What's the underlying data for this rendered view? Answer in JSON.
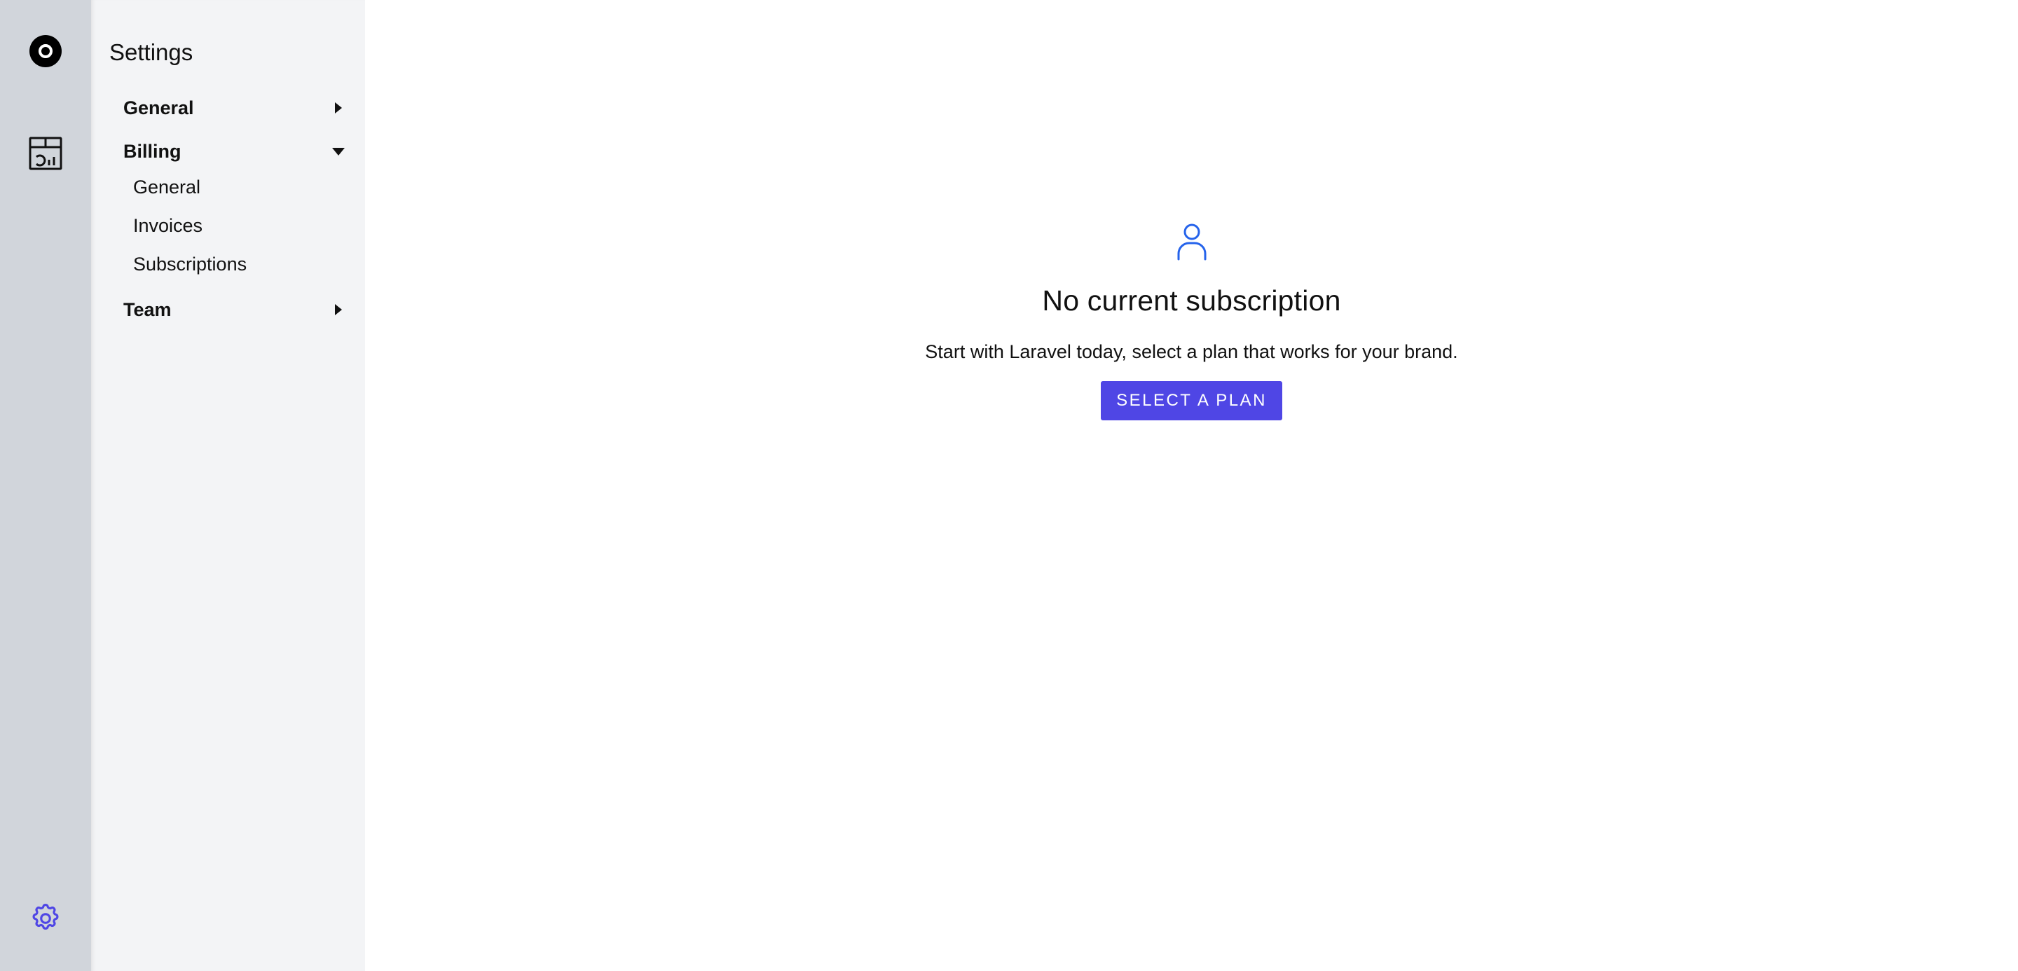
{
  "rail": {
    "icons": [
      "logo-icon",
      "dashboard-icon",
      "gear-icon"
    ],
    "accent": "#4f46e5",
    "background": "#d1d5db"
  },
  "sidebar": {
    "title": "Settings",
    "groups": [
      {
        "label": "General",
        "expanded": false
      },
      {
        "label": "Billing",
        "expanded": true,
        "items": [
          {
            "label": "General"
          },
          {
            "label": "Invoices"
          },
          {
            "label": "Subscriptions"
          }
        ]
      },
      {
        "label": "Team",
        "expanded": false
      }
    ]
  },
  "main": {
    "empty_state": {
      "icon": "user-icon",
      "icon_color": "#2563eb",
      "title": "No current subscription",
      "description": "Start with Laravel today, select a plan that works for your brand.",
      "button_label": "SELECT A PLAN",
      "button_color": "#4f46e5"
    }
  }
}
